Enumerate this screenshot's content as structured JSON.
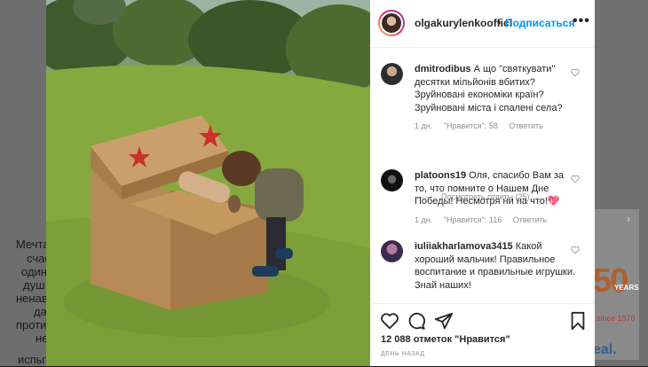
{
  "background": {
    "left_text": [
      "Мечта",
      "счас",
      "один",
      "душ",
      "ненави",
      "да",
      "проти",
      "не",
      "испыт"
    ],
    "promo_number": "50",
    "promo_years": "YEARS",
    "promo_since": "since 1970",
    "promo_deal": "eal."
  },
  "post": {
    "username": "olgakurylenkooffici",
    "dot": "•",
    "follow_label": "Подписаться",
    "more_label": "•••",
    "comments": [
      {
        "author": "dmitrodibus",
        "text": "А що \"святкувати\" десятки мільйонів вбитих? Зруйновані економіки країн? Зруйновані міста і спалені села?",
        "time": "1 дн.",
        "likes": "\"Нравится\": 58",
        "reply": "Ответить"
      },
      {
        "author": "platoons19",
        "text": "Оля, спасибо Вам за то, что помните о Нашем Дне Победы! Несмотря ни на что!💖",
        "time": "1 дн.",
        "likes": "\"Нравится\": 116",
        "reply": "Ответить"
      },
      {
        "author": "iuliiakharlamova3415",
        "text": "Какой хороший мальчик! Правильное воспитание и правильные игрушки. Знай наших!",
        "time": "",
        "likes": "",
        "reply": ""
      }
    ],
    "view_replies": "Посмотреть ответы (25)",
    "likes_count": "12 088 отметок \"Нравится\"",
    "timestamp": "ДЕНЬ НАЗАД",
    "colors": {
      "accent": "#0095f6",
      "text": "#262626",
      "muted": "#8e8e8e"
    }
  }
}
